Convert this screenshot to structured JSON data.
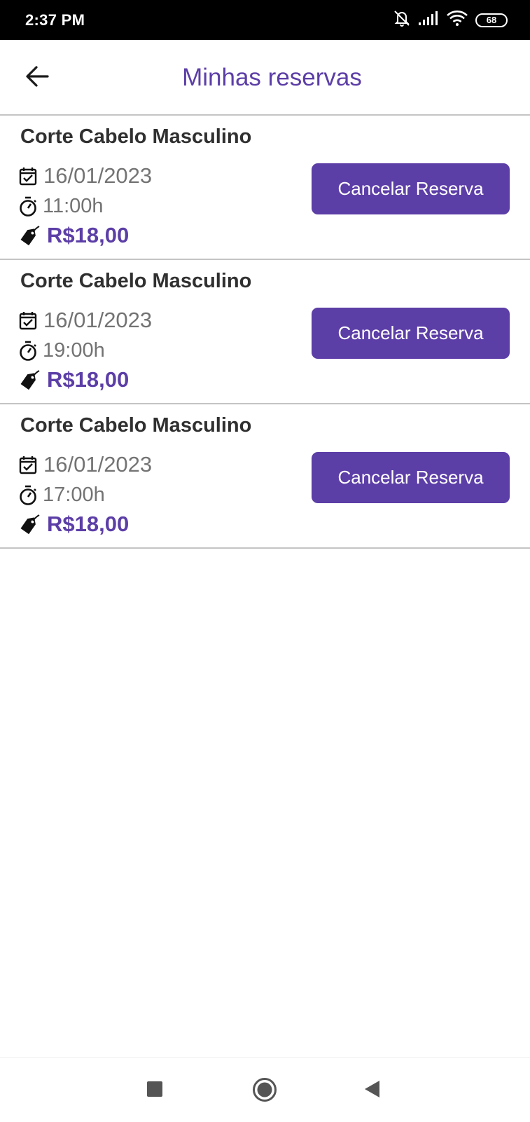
{
  "status_bar": {
    "time": "2:37 PM",
    "battery": "68",
    "icons": [
      "notifications-off-icon",
      "signal-icon",
      "wifi-icon",
      "battery-icon"
    ]
  },
  "header": {
    "title": "Minhas reservas",
    "back_icon": "arrow-left-icon"
  },
  "reservations": [
    {
      "service": "Corte Cabelo Masculino",
      "date": "16/01/2023",
      "time": "11:00h",
      "price": "R$18,00",
      "cancel_label": "Cancelar Reserva"
    },
    {
      "service": "Corte Cabelo Masculino",
      "date": "16/01/2023",
      "time": "19:00h",
      "price": "R$18,00",
      "cancel_label": "Cancelar Reserva"
    },
    {
      "service": "Corte Cabelo Masculino",
      "date": "16/01/2023",
      "time": "17:00h",
      "price": "R$18,00",
      "cancel_label": "Cancelar Reserva"
    }
  ],
  "nav_bar": {
    "buttons": [
      "recents-square-icon",
      "home-circle-icon",
      "back-triangle-icon"
    ]
  },
  "colors": {
    "accent": "#5c3ea7",
    "text_dark": "#303030",
    "text_muted": "#737373",
    "divider": "#c4c4c4"
  }
}
